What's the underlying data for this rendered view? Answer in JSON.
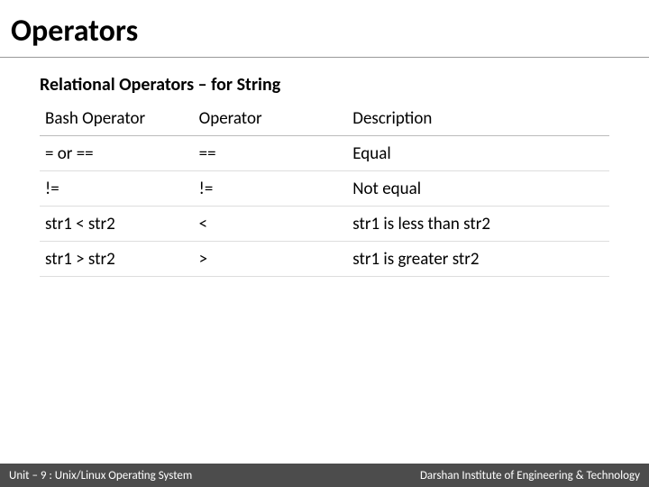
{
  "title": "Operators",
  "section": "Relational Operators – for String",
  "table": {
    "headers": [
      "Bash Operator",
      "Operator",
      "Description"
    ],
    "rows": [
      {
        "bash": "= or ==",
        "op": "==",
        "desc": "Equal"
      },
      {
        "bash": "!=",
        "op": "!=",
        "desc": "Not equal"
      },
      {
        "bash": "str1 < str2",
        "op": "<",
        "desc": "str1 is less than str2"
      },
      {
        "bash": "str1 > str2",
        "op": ">",
        "desc": "str1 is greater str2"
      }
    ]
  },
  "footer": {
    "left": "Unit – 9 : Unix/Linux Operating System",
    "right": "Darshan Institute of Engineering & Technology"
  }
}
